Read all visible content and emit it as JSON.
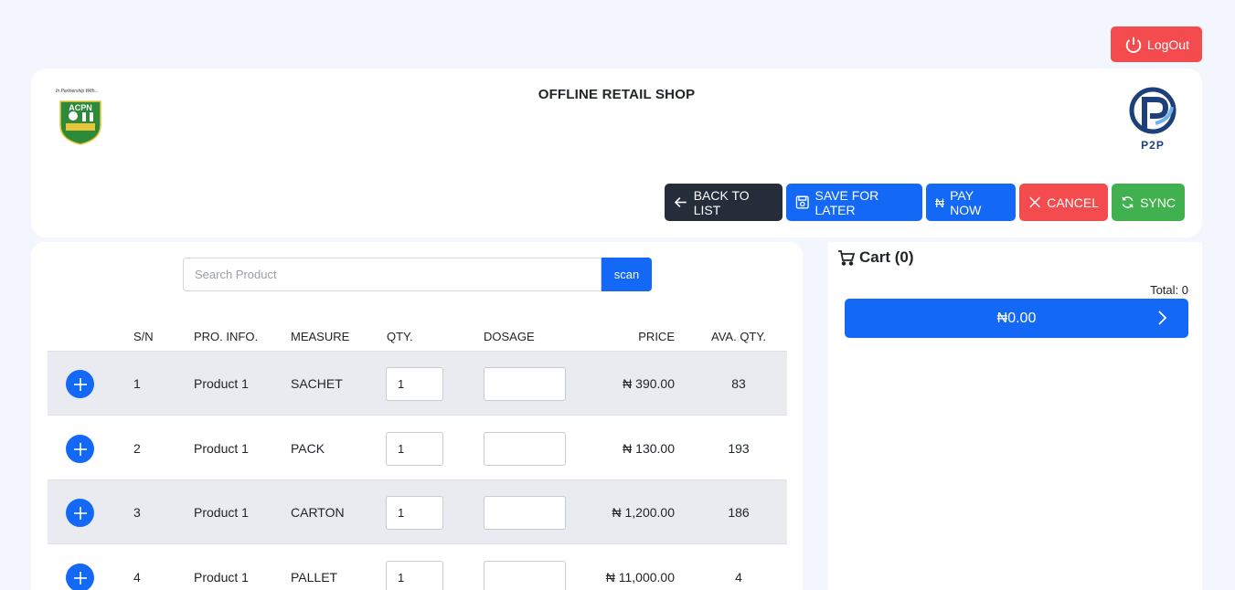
{
  "logout": {
    "label": "LogOut",
    "icon": "power-icon"
  },
  "header": {
    "title": "OFFLINE RETAIL SHOP",
    "left_logo": {
      "tagline": "In Partnership With...",
      "text": "ACPN"
    },
    "right_logo": {
      "text": "P2P"
    }
  },
  "actions": [
    {
      "label": "BACK TO LIST",
      "icon": "arrow-left-icon",
      "color": "#252c3a"
    },
    {
      "label": "SAVE FOR LATER",
      "icon": "save-icon",
      "color": "#1368f5"
    },
    {
      "label": "PAY NOW",
      "icon": "naira-icon",
      "color": "#1368f5"
    },
    {
      "label": "CANCEL",
      "icon": "close-icon",
      "color": "#f44b4e"
    },
    {
      "label": "SYNC",
      "icon": "sync-icon",
      "color": "#41b04f"
    }
  ],
  "search": {
    "placeholder": "Search Product",
    "button": "scan"
  },
  "table": {
    "headers": {
      "sn": "S/N",
      "info": "PRO. INFO.",
      "measure": "MEASURE",
      "qty": "QTY.",
      "dosage": "DOSAGE",
      "price": "PRICE",
      "ava": "AVA. QTY."
    },
    "rows": [
      {
        "sn": "1",
        "info": "Product 1",
        "measure": "SACHET",
        "qty": "1",
        "price": "₦ 390.00",
        "ava": "83"
      },
      {
        "sn": "2",
        "info": "Product 1",
        "measure": "PACK",
        "qty": "1",
        "price": "₦ 130.00",
        "ava": "193"
      },
      {
        "sn": "3",
        "info": "Product 1",
        "measure": "CARTON",
        "qty": "1",
        "price": "₦ 1,200.00",
        "ava": "186"
      },
      {
        "sn": "4",
        "info": "Product 1",
        "measure": "PALLET",
        "qty": "1",
        "price": "₦ 11,000.00",
        "ava": "4"
      }
    ]
  },
  "cart": {
    "title": "Cart (0)",
    "total": "Total: 0",
    "amount": "₦0.00"
  }
}
